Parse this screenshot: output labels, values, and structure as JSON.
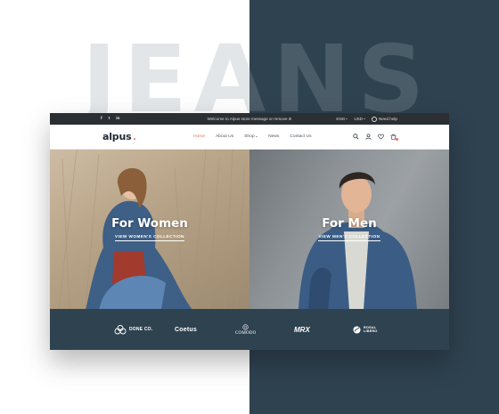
{
  "hero_word": "JEANS",
  "colors": {
    "background_dark": "#2f4250",
    "accent": "#f06a5a",
    "topbar": "#2b2f33",
    "hero_text_light": "#e3e6e8"
  },
  "topbar": {
    "social_icons": [
      "facebook-icon",
      "twitter-icon",
      "linkedin-icon"
    ],
    "social_glyphs": [
      "f",
      "t",
      "in"
    ],
    "announcement": "Welcome to Alpus store message or remove it!",
    "language": "ENG",
    "currency": "USD",
    "help": "Need help"
  },
  "nav": {
    "logo": "alpus",
    "menu": [
      "Home",
      "About Us",
      "Shop",
      "News",
      "Contact Us"
    ],
    "active_index": 0,
    "icons": [
      "search-icon",
      "user-icon",
      "heart-icon",
      "cart-icon"
    ]
  },
  "panels": {
    "women": {
      "title": "For Women",
      "link": "VIEW WOMEN'S COLLECTION"
    },
    "men": {
      "title": "For Men",
      "link": "VIEW MEN'S COLLECTION"
    }
  },
  "brands": [
    {
      "name": "DONE CO.",
      "sub": ""
    },
    {
      "name": "Coetus",
      "sub": ""
    },
    {
      "name": "COMODO",
      "sub": ""
    },
    {
      "name": "MRX",
      "sub": ""
    },
    {
      "name": "ROSAL LIBERO",
      "sub": ""
    }
  ]
}
